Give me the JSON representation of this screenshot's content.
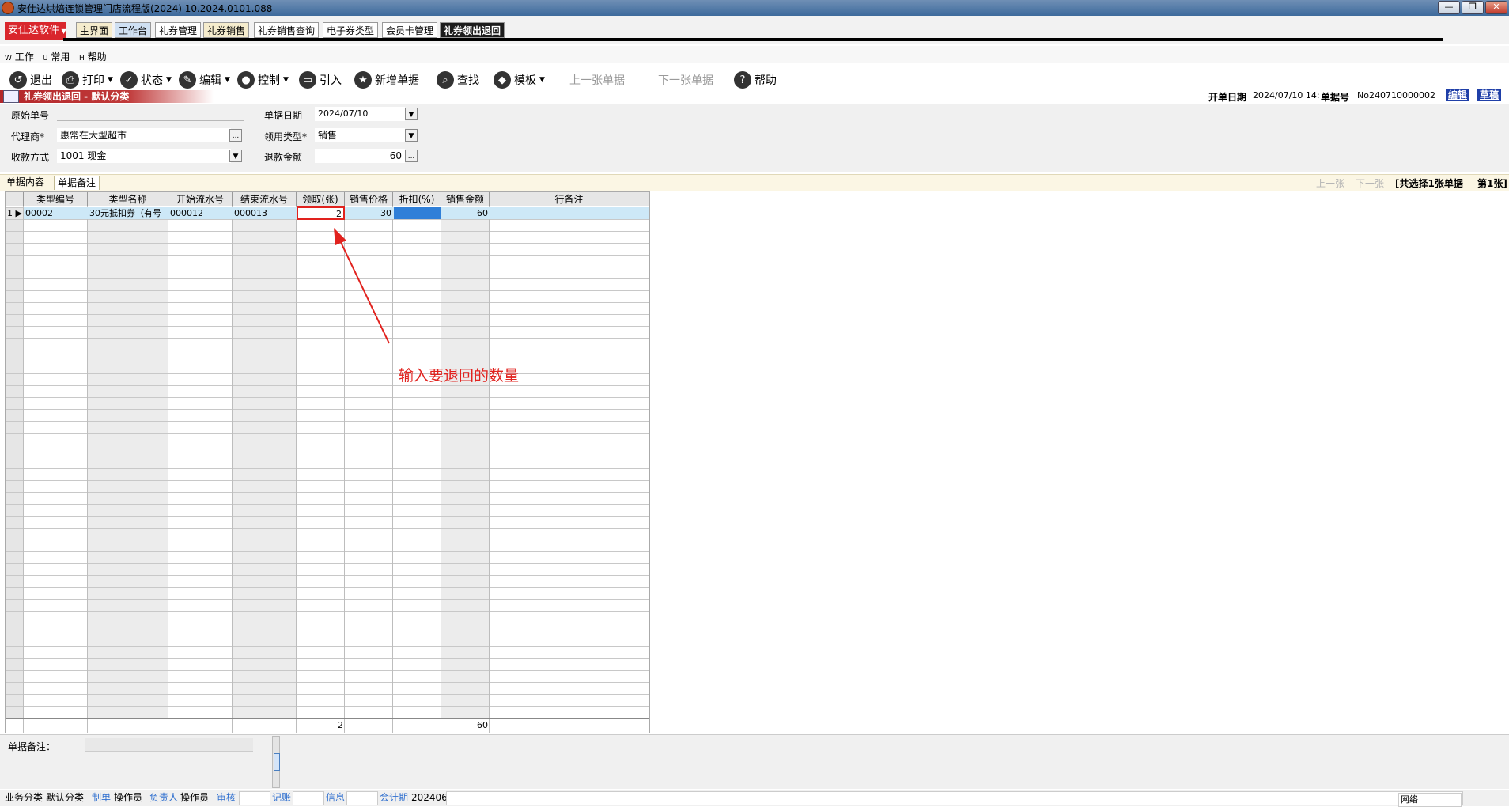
{
  "window": {
    "title": "安仕达烘焙连锁管理门店流程版(2024)   10.2024.0101.088",
    "controls": [
      "—",
      "❐",
      "✕"
    ]
  },
  "brand": {
    "label": "安仕达软件"
  },
  "tabs": [
    {
      "label": "主界面"
    },
    {
      "label": "工作台"
    },
    {
      "label": "礼券管理"
    },
    {
      "label": "礼券销售"
    },
    {
      "label": "礼券销售查询"
    },
    {
      "label": "电子券类型"
    },
    {
      "label": "会员卡管理"
    },
    {
      "label": "礼券领出退回"
    }
  ],
  "menu": [
    {
      "key": "W",
      "label": "工作"
    },
    {
      "key": "U",
      "label": "常用"
    },
    {
      "key": "H",
      "label": "帮助"
    }
  ],
  "toolbar": {
    "exit": "退出",
    "print": "打印",
    "status": "状态",
    "edit": "编辑",
    "control": "控制",
    "import": "引入",
    "new_doc": "新增单据",
    "find": "查找",
    "template": "模板",
    "prev_doc": "上一张单据",
    "next_doc": "下一张单据",
    "help": "帮助"
  },
  "doc_header": {
    "caption": "礼券领出退回 - 默认分类",
    "date_label": "开单日期",
    "date_value": "2024/07/10 14:",
    "no_label": "单据号",
    "no_value": "No240710000002",
    "edit_btn": "编辑",
    "draft_btn": "草稿"
  },
  "form": {
    "orig_no_label": "原始单号",
    "orig_no_value": "",
    "agent_label": "代理商*",
    "agent_value": "惠常在大型超市",
    "payment_label": "收款方式",
    "payment_value": "1001 现金",
    "date_label": "单据日期",
    "date_value": "2024/07/10",
    "type_label": "领用类型*",
    "type_value": "销售",
    "refund_label": "退款金额",
    "refund_value": "60",
    "ellipsis": "..."
  },
  "subtabs": {
    "content": "单据内容",
    "remarks": "单据备注",
    "prev": "上一张",
    "next": "下一张",
    "selection": "[共选择1张单据",
    "page": "第1张]"
  },
  "grid": {
    "columns": [
      "类型编号",
      "类型名称",
      "开始流水号",
      "结束流水号",
      "领取(张)",
      "销售价格",
      "折扣(%)",
      "销售金额",
      "行备注"
    ],
    "rows": [
      {
        "index": "1",
        "type_code": "00002",
        "type_name": "30元抵扣券（有号",
        "start_no": "000012",
        "end_no": "000013",
        "qty": "2",
        "price": "30",
        "discount": "",
        "amount": "60",
        "remark": ""
      }
    ],
    "totals": {
      "qty": "2",
      "amount": "60"
    }
  },
  "annotation": {
    "text": "输入要退回的数量",
    "color": "#e1221e"
  },
  "note": {
    "label": "单据备注：",
    "value": ""
  },
  "statusbar": {
    "category_label": "业务分类",
    "category_value": "默认分类",
    "maker_label": "制单",
    "maker_value": "操作员",
    "owner_label": "负责人",
    "owner_value": "操作员",
    "audit_label": "审核",
    "audit_value": "",
    "post_label": "记账",
    "post_value": "",
    "info_label": "信息",
    "info_value": "",
    "period_label": "会计期",
    "period_value": "202406",
    "network": "网络"
  },
  "colors": {
    "brand_red": "#d9262c",
    "active_tab": "#1c1c1c",
    "selected_row": "#cde8f7",
    "discount_cell": "#2f7fd8",
    "highlight_box": "#e1221e"
  }
}
